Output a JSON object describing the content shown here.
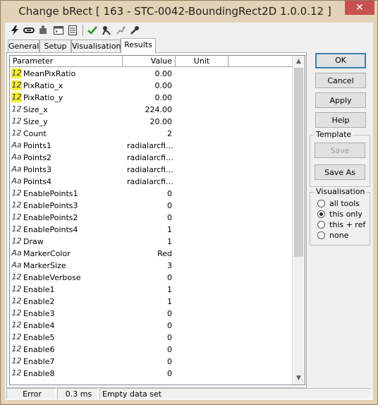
{
  "window": {
    "title": "Change bRect [ 163 - STC-0042-BoundingRect2D 1.0.0.12 ]",
    "close_glyph": "✕"
  },
  "toolbar": {
    "icons": [
      "lightning-icon",
      "link-icon",
      "puzzle-icon",
      "console-icon",
      "list-icon",
      "check-icon",
      "run-icon",
      "graph-icon",
      "wrench-icon"
    ]
  },
  "tabs": [
    "General",
    "Setup",
    "Visualisation",
    "Results"
  ],
  "active_tab": "Results",
  "grid": {
    "headers": {
      "parameter": "Parameter",
      "value": "Value",
      "unit": "Unit"
    },
    "rows": [
      {
        "icon": "12",
        "highlight": true,
        "name": "MeanPixRatio",
        "value": "0.00"
      },
      {
        "icon": "12",
        "highlight": true,
        "name": "PixRatio_x",
        "value": "0.00"
      },
      {
        "icon": "12",
        "highlight": true,
        "name": "PixRatio_y",
        "value": "0.00"
      },
      {
        "icon": "12",
        "highlight": false,
        "name": "Size_x",
        "value": "224.00"
      },
      {
        "icon": "12",
        "highlight": false,
        "name": "Size_y",
        "value": "20.00"
      },
      {
        "icon": "12",
        "highlight": false,
        "name": "Count",
        "value": "2"
      },
      {
        "icon": "Aa",
        "highlight": false,
        "name": "Points1",
        "value": "radialarcfi...",
        "text": true
      },
      {
        "icon": "Aa",
        "highlight": false,
        "name": "Points2",
        "value": "radialarcfi...",
        "text": true
      },
      {
        "icon": "Aa",
        "highlight": false,
        "name": "Points3",
        "value": "radialarcfi...",
        "text": true
      },
      {
        "icon": "Aa",
        "highlight": false,
        "name": "Points4",
        "value": "radialarcfi...",
        "text": true
      },
      {
        "icon": "12",
        "highlight": false,
        "name": "EnablePoints1",
        "value": "0"
      },
      {
        "icon": "12",
        "highlight": false,
        "name": "EnablePoints3",
        "value": "0"
      },
      {
        "icon": "12",
        "highlight": false,
        "name": "EnablePoints2",
        "value": "0"
      },
      {
        "icon": "12",
        "highlight": false,
        "name": "EnablePoints4",
        "value": "1"
      },
      {
        "icon": "12",
        "highlight": false,
        "name": "Draw",
        "value": "1"
      },
      {
        "icon": "Aa",
        "highlight": false,
        "name": "MarkerColor",
        "value": "Red"
      },
      {
        "icon": "Aa",
        "highlight": false,
        "name": "MarkerSize",
        "value": "3"
      },
      {
        "icon": "12",
        "highlight": false,
        "name": "EnableVerbose",
        "value": "0"
      },
      {
        "icon": "12",
        "highlight": false,
        "name": "Enable1",
        "value": "1"
      },
      {
        "icon": "12",
        "highlight": false,
        "name": "Enable2",
        "value": "1"
      },
      {
        "icon": "12",
        "highlight": false,
        "name": "Enable3",
        "value": "0"
      },
      {
        "icon": "12",
        "highlight": false,
        "name": "Enable4",
        "value": "0"
      },
      {
        "icon": "12",
        "highlight": false,
        "name": "Enable5",
        "value": "0"
      },
      {
        "icon": "12",
        "highlight": false,
        "name": "Enable6",
        "value": "0"
      },
      {
        "icon": "12",
        "highlight": false,
        "name": "Enable7",
        "value": "0"
      },
      {
        "icon": "12",
        "highlight": false,
        "name": "Enable8",
        "value": "0"
      }
    ]
  },
  "buttons": {
    "ok": "OK",
    "cancel": "Cancel",
    "apply": "Apply",
    "help": "Help"
  },
  "template": {
    "title": "Template",
    "save": "Save",
    "save_as": "Save As"
  },
  "visualisation": {
    "title": "Visualisation",
    "options": [
      "all tools",
      "this only",
      "this + ref",
      "none"
    ],
    "selected": "this only"
  },
  "status": {
    "state": "Error",
    "time": "0.3 ms",
    "message": "Empty data set"
  },
  "colors": {
    "highlight": "#f6ee3c",
    "frame": "#e3d3b6",
    "close": "#c75050",
    "default_border": "#3c7fb1"
  }
}
